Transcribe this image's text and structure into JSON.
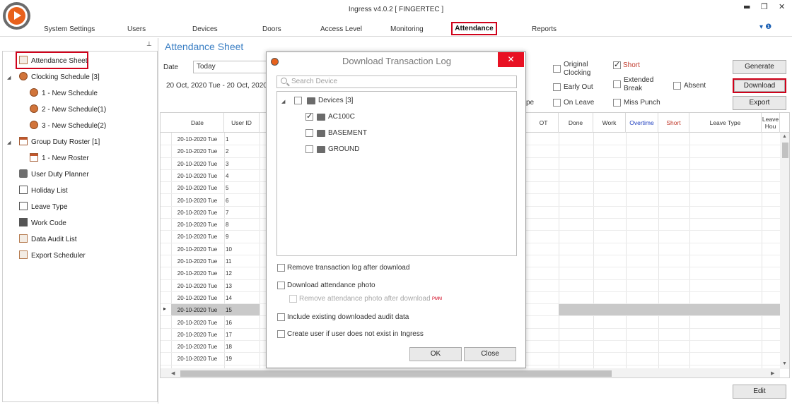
{
  "window": {
    "title": "Ingress v4.0.2 [ FINGERTEC ]",
    "controls": {
      "minimize": "▬",
      "restore": "❐",
      "close": "✕"
    }
  },
  "ribbon": {
    "help_icon": "▾ ❶",
    "menu": [
      "System Settings",
      "Users",
      "Devices",
      "Doors",
      "Access Level",
      "Monitoring",
      "Attendance",
      "Reports"
    ]
  },
  "sidebar": {
    "pin": "📌",
    "items": [
      {
        "label": "Attendance Sheet",
        "icon": "sheet-icon"
      },
      {
        "label": "Clocking Schedule [3]",
        "icon": "clock-icon"
      },
      {
        "label": "1 - New Schedule",
        "icon": "clock-icon"
      },
      {
        "label": "2 - New Schedule(1)",
        "icon": "clock-icon"
      },
      {
        "label": "3 - New Schedule(2)",
        "icon": "clock-icon"
      },
      {
        "label": "Group Duty Roster [1]",
        "icon": "roster-icon"
      },
      {
        "label": "1 - New Roster",
        "icon": "roster-icon"
      },
      {
        "label": "User Duty Planner",
        "icon": "briefcase-icon"
      },
      {
        "label": "Holiday List",
        "icon": "sandals-icon"
      },
      {
        "label": "Leave Type",
        "icon": "list-icon"
      },
      {
        "label": "Work Code",
        "icon": "workcode-icon"
      },
      {
        "label": "Data Audit List",
        "icon": "audit-icon"
      },
      {
        "label": "Export Scheduler",
        "icon": "export-icon"
      }
    ]
  },
  "main": {
    "title": "Attendance Sheet",
    "date_label": "Date",
    "date_value": "Today",
    "range": "20 Oct, 2020 Tue - 20 Oct, 2020 T",
    "options": {
      "original_clocking": "Original Clocking",
      "short": "Short",
      "early_out": "Early Out",
      "extended_break": "Extended Break",
      "absent": "Absent",
      "on_leave": "On Leave",
      "miss_punch": "Miss Punch",
      "partial": "pe"
    },
    "buttons": {
      "generate": "Generate",
      "download": "Download",
      "export": "Export",
      "edit": "Edit"
    }
  },
  "grid": {
    "columns": [
      "Date",
      "User ID",
      "OT",
      "Done",
      "Work",
      "Overtime",
      "Short",
      "Leave Type",
      "Leave Hou"
    ],
    "overtime_color": "#1f3fbf",
    "short_color": "#c0392b",
    "rows": [
      {
        "date": "20-10-2020  Tue",
        "id": "1"
      },
      {
        "date": "20-10-2020  Tue",
        "id": "2"
      },
      {
        "date": "20-10-2020  Tue",
        "id": "3"
      },
      {
        "date": "20-10-2020  Tue",
        "id": "4"
      },
      {
        "date": "20-10-2020  Tue",
        "id": "5"
      },
      {
        "date": "20-10-2020  Tue",
        "id": "6"
      },
      {
        "date": "20-10-2020  Tue",
        "id": "7"
      },
      {
        "date": "20-10-2020  Tue",
        "id": "8"
      },
      {
        "date": "20-10-2020  Tue",
        "id": "9"
      },
      {
        "date": "20-10-2020  Tue",
        "id": "10"
      },
      {
        "date": "20-10-2020  Tue",
        "id": "11"
      },
      {
        "date": "20-10-2020  Tue",
        "id": "12"
      },
      {
        "date": "20-10-2020  Tue",
        "id": "13"
      },
      {
        "date": "20-10-2020  Tue",
        "id": "14"
      },
      {
        "date": "20-10-2020  Tue",
        "id": "15"
      },
      {
        "date": "20-10-2020  Tue",
        "id": "16"
      },
      {
        "date": "20-10-2020  Tue",
        "id": "17"
      },
      {
        "date": "20-10-2020  Tue",
        "id": "18"
      },
      {
        "date": "20-10-2020  Tue",
        "id": "19"
      }
    ],
    "selected_row_index": 14,
    "row_pointer": "▸"
  },
  "dialog": {
    "title": "Download Transaction Log",
    "close": "✕",
    "search_placeholder": "Search Device",
    "tree": {
      "root": "Devices [3]",
      "devices": [
        {
          "name": "AC100C",
          "checked": true
        },
        {
          "name": "BASEMENT",
          "checked": false
        },
        {
          "name": "GROUND",
          "checked": false
        }
      ]
    },
    "options": {
      "remove_log": "Remove transaction log after download",
      "download_photo": "Download attendance photo",
      "remove_photo": "Remove attendance photo after download",
      "pmm": "PMM",
      "include_audit": "Include existing downloaded audit data",
      "create_user": "Create user if user does not exist in Ingress"
    },
    "buttons": {
      "ok": "OK",
      "close": "Close"
    }
  }
}
